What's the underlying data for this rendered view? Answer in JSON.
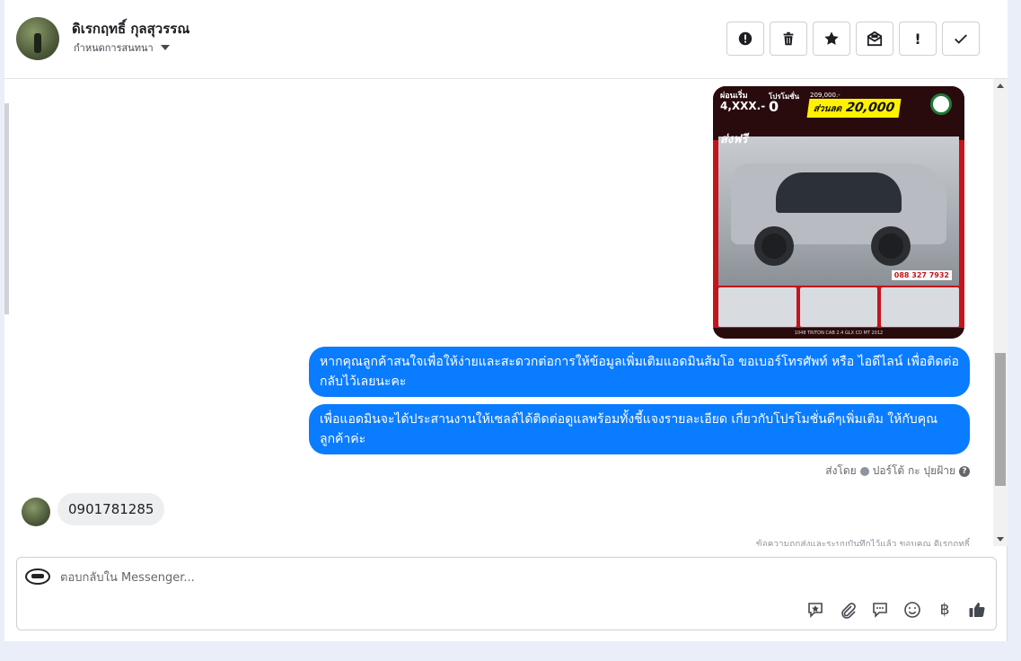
{
  "header": {
    "contact_name": "ดิเรกฤทธิ์ กุลสุวรรณ",
    "conversation_setting": "กำหนดการสนทนา"
  },
  "actions": {
    "spam_label": "!",
    "done_label": "✓"
  },
  "thread": {
    "image_ad": {
      "monthly_label": "ผ่อนเริ่ม",
      "monthly_value": "4,XXX.-",
      "promo_label": "โปรโมชั่น",
      "promo_down": "0",
      "price": "209,000.-",
      "discount_label": "ส่วนลด",
      "discount_value": "20,000",
      "free_ship": "ส่งฟรี",
      "caption": "1048 TRITON CAB 2.4 GLX CD MT 2012",
      "phone": "088 327 7932"
    },
    "outgoing_messages": [
      "หากคุณลูกค้าสนใจเพื่อให้ง่ายและสะดวกต่อการให้ข้อมูลเพิ่มเติมแอดมินส้มโอ ขอเบอร์โทรศัพท์ หรือ ไอดีไลน์ เพื่อติดต่อกลับไว้เลยนะคะ",
      "เพื่อแอดมินจะได้ประสานงานให้เซลล์ได้ติดต่อดูแลพร้อมทั้งชี้แจงรายละเอียด เกี่ยวกับโปรโมชั่นดีๆเพิ่มเติม ให้กับคุณลูกค้าค่ะ"
    ],
    "sent_by_prefix": "ส่งโดย",
    "sent_by_name": "ปอร์โต้ กะ ปุยฝ้าย",
    "incoming_message": "0901781285",
    "partial_note": "ข้อความถูกส่งและระบบบันทึกไว้แล้ว ขอบคุณ ดิเรกฤทธิ์"
  },
  "composer": {
    "placeholder": "ตอบกลับใน Messenger...",
    "baht_symbol": "฿"
  },
  "colors": {
    "accent": "#0a7cff",
    "incoming_bubble": "#eceef0"
  },
  "icons": [
    "alert-icon",
    "trash-icon",
    "star-icon",
    "mark-unread-icon",
    "spam-icon",
    "check-icon",
    "saved-reply-icon",
    "attachment-icon",
    "chat-bubble-icon",
    "emoji-icon",
    "baht-icon",
    "thumbs-up-icon"
  ]
}
